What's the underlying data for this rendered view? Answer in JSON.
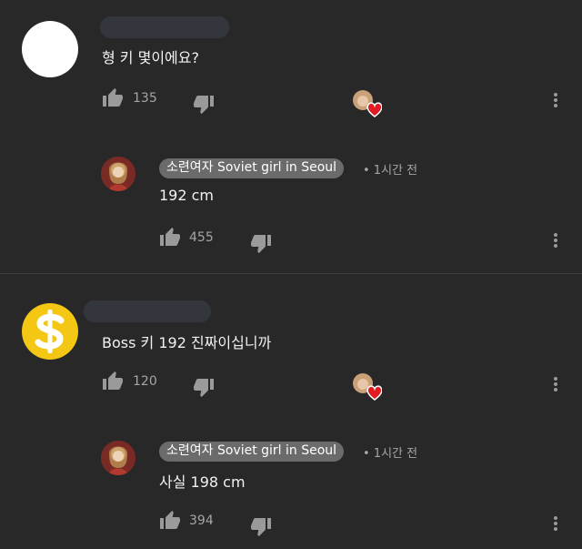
{
  "comments": [
    {
      "text": "형 키 몇이에요?",
      "likes": "135",
      "reply": {
        "author": "소련여자 Soviet girl in Seoul",
        "time": "• 1시간 전",
        "text": "192 cm",
        "likes": "455"
      }
    },
    {
      "text": "Boss 키 192 진짜이십니까",
      "likes": "120",
      "reply": {
        "author": "소련여자 Soviet girl in Seoul",
        "time": "• 1시간 전",
        "text": "사실 198 cm",
        "likes": "394"
      }
    }
  ],
  "icons": {
    "like": "thumbs-up-icon",
    "dislike": "thumbs-down-icon",
    "more": "more-vert-icon",
    "creator_heart": "creator-heart-icon"
  },
  "colors": {
    "background": "#282828",
    "heart": "#e21b23",
    "chip": "#6b6b6b",
    "dollar_avatar": "#f3c714"
  }
}
